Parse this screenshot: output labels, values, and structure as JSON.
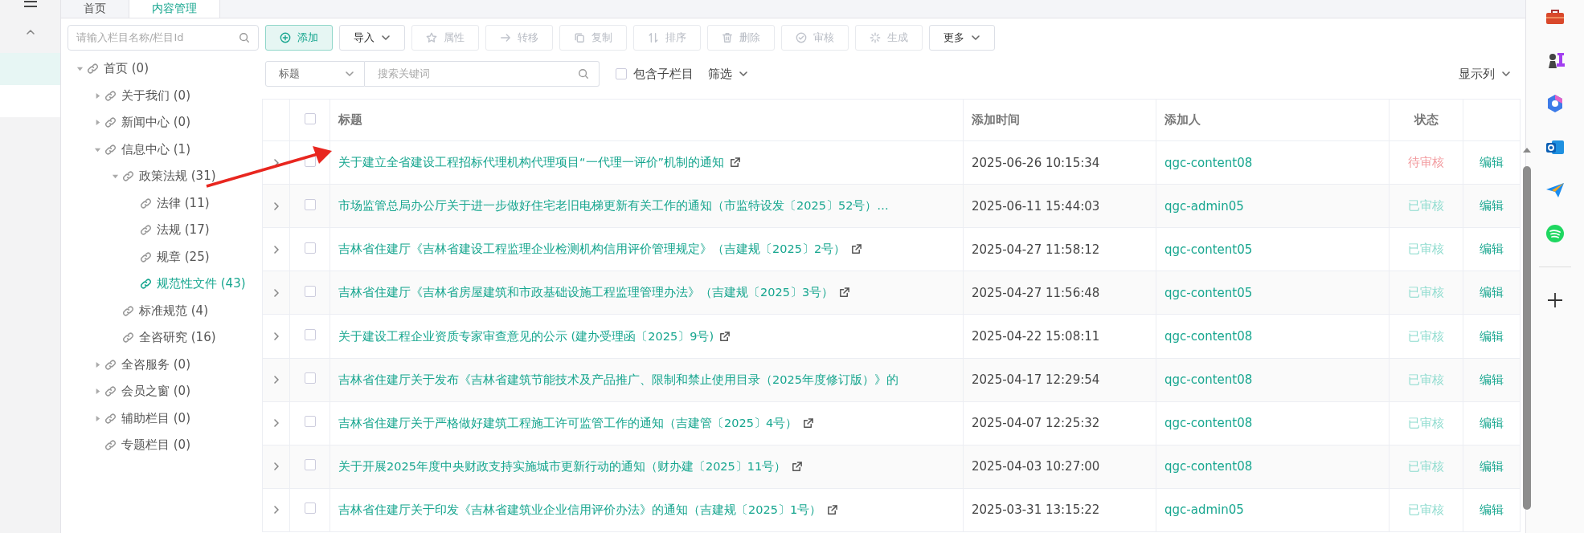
{
  "tabs": [
    {
      "label": "首页",
      "selected": false
    },
    {
      "label": "内容管理",
      "selected": true
    }
  ],
  "tree": {
    "search_placeholder": "请输入栏目名称/栏目Id",
    "items": [
      {
        "label": "首页 (0)",
        "kind": "branch",
        "expanded": true,
        "selected": false,
        "children": [
          {
            "label": "关于我们 (0)",
            "kind": "branch",
            "expanded": false,
            "selected": false
          },
          {
            "label": "新闻中心 (0)",
            "kind": "branch",
            "expanded": false,
            "selected": false
          },
          {
            "label": "信息中心 (1)",
            "kind": "branch",
            "expanded": true,
            "selected": false,
            "children": [
              {
                "label": "政策法规 (31)",
                "kind": "branch",
                "expanded": true,
                "selected": false,
                "children": [
                  {
                    "label": "法律 (11)",
                    "kind": "leaf",
                    "selected": false
                  },
                  {
                    "label": "法规 (17)",
                    "kind": "leaf",
                    "selected": false
                  },
                  {
                    "label": "规章 (25)",
                    "kind": "leaf",
                    "selected": false
                  },
                  {
                    "label": "规范性文件 (43)",
                    "kind": "leaf",
                    "selected": true
                  }
                ]
              },
              {
                "label": "标准规范 (4)",
                "kind": "leaf",
                "selected": false
              },
              {
                "label": "全咨研究 (16)",
                "kind": "leaf",
                "selected": false
              }
            ]
          },
          {
            "label": "全咨服务 (0)",
            "kind": "branch",
            "expanded": false,
            "selected": false
          },
          {
            "label": "会员之窗 (0)",
            "kind": "branch",
            "expanded": false,
            "selected": false
          },
          {
            "label": "辅助栏目 (0)",
            "kind": "branch",
            "expanded": false,
            "selected": false
          },
          {
            "label": "专题栏目 (0)",
            "kind": "leaf",
            "selected": false
          }
        ]
      }
    ]
  },
  "toolbar": [
    {
      "label": "添加",
      "kind": "primary",
      "disabled": false
    },
    {
      "label": "导入",
      "kind": "dropdown",
      "disabled": false
    },
    {
      "label": "属性",
      "kind": "plain",
      "disabled": true
    },
    {
      "label": "转移",
      "kind": "plain",
      "disabled": true
    },
    {
      "label": "复制",
      "kind": "plain",
      "disabled": true
    },
    {
      "label": "排序",
      "kind": "plain",
      "disabled": true
    },
    {
      "label": "删除",
      "kind": "plain",
      "disabled": true
    },
    {
      "label": "审核",
      "kind": "plain",
      "disabled": true
    },
    {
      "label": "生成",
      "kind": "plain",
      "disabled": true
    },
    {
      "label": "更多",
      "kind": "dropdown",
      "disabled": false
    }
  ],
  "filter": {
    "field_select": "标题",
    "search_placeholder": "搜索关键词",
    "include_sub": {
      "label": "包含子栏目",
      "checked": false
    },
    "filter_menu": "筛选",
    "columns_menu": "显示列"
  },
  "table": {
    "select_all_checked": false,
    "columns": [
      "标题",
      "添加时间",
      "添加人",
      "状态"
    ],
    "rows": [
      {
        "title": "关于建立全省建设工程招标代理机构代理项目“一代理一评价”机制的通知",
        "external_link": true,
        "time": "2025-06-26 10:15:34",
        "author": "qgc-content08",
        "status": "待审核",
        "pending": true,
        "action": "编辑",
        "checked": false
      },
      {
        "title": "市场监管总局办公厅关于进一步做好住宅老旧电梯更新有关工作的通知（市监特设发〔2025〕52号）…",
        "external_link": false,
        "time": "2025-06-11 15:44:03",
        "author": "qgc-admin05",
        "status": "已审核",
        "pending": false,
        "action": "编辑",
        "checked": false
      },
      {
        "title": "吉林省住建厅《吉林省建设工程监理企业检测机构信用评价管理规定》（吉建规〔2025〕2号）",
        "external_link": true,
        "time": "2025-04-27 11:58:12",
        "author": "qgc-content05",
        "status": "已审核",
        "pending": false,
        "action": "编辑",
        "checked": false
      },
      {
        "title": "吉林省住建厅《吉林省房屋建筑和市政基础设施工程监理管理办法》（吉建规〔2025〕3号）",
        "external_link": true,
        "time": "2025-04-27 11:56:48",
        "author": "qgc-content05",
        "status": "已审核",
        "pending": false,
        "action": "编辑",
        "checked": false
      },
      {
        "title": "关于建设工程企业资质专家审查意见的公示 (建办受理函〔2025〕9号)",
        "external_link": true,
        "time": "2025-04-22 15:08:11",
        "author": "qgc-content08",
        "status": "已审核",
        "pending": false,
        "action": "编辑",
        "checked": false
      },
      {
        "title": "吉林省住建厅关于发布《吉林省建筑节能技术及产品推广、限制和禁止使用目录（2025年度修订版）》的",
        "external_link": false,
        "time": "2025-04-17 12:29:54",
        "author": "qgc-content08",
        "status": "已审核",
        "pending": false,
        "action": "编辑",
        "checked": false
      },
      {
        "title": "吉林省住建厅关于严格做好建筑工程施工许可监管工作的通知（吉建管〔2025〕4号）",
        "external_link": true,
        "time": "2025-04-07 12:25:32",
        "author": "qgc-content08",
        "status": "已审核",
        "pending": false,
        "action": "编辑",
        "checked": false
      },
      {
        "title": "关于开展2025年度中央财政支持实施城市更新行动的通知（财办建〔2025〕11号）",
        "external_link": true,
        "time": "2025-04-03 10:27:00",
        "author": "qgc-content08",
        "status": "已审核",
        "pending": false,
        "action": "编辑",
        "checked": false
      },
      {
        "title": "吉林省住建厅关于印发《吉林省建筑业企业信用评价办法》的通知（吉建规〔2025〕1号）",
        "external_link": true,
        "time": "2025-03-31 13:15:22",
        "author": "qgc-admin05",
        "status": "已审核",
        "pending": false,
        "action": "编辑",
        "checked": false
      }
    ]
  }
}
